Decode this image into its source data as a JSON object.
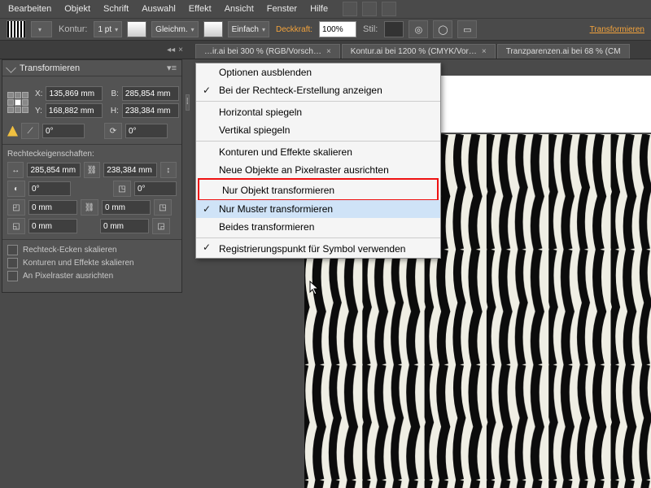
{
  "menubar": [
    "Bearbeiten",
    "Objekt",
    "Schrift",
    "Auswahl",
    "Effekt",
    "Ansicht",
    "Fenster",
    "Hilfe"
  ],
  "toolbar": {
    "kontur_label": "Kontur:",
    "stroke_value": "1 pt",
    "dash1": "Gleichm.",
    "dash2": "Einfach",
    "opacity_label": "Deckkraft:",
    "opacity_value": "100%",
    "style_label": "Stil:",
    "right_link": "Transformieren"
  },
  "tabs": [
    {
      "label": "…ir.ai bei 300 % (RGB/Vorsch…"
    },
    {
      "label": "Kontur.ai bei 1200 % (CMYK/Vor…"
    },
    {
      "label": "Tranzparenzen.ai bei 68 % (CM"
    }
  ],
  "panel": {
    "title": "Transformieren",
    "x_label": "X:",
    "x_val": "135,869 mm",
    "y_label": "Y:",
    "y_val": "168,882 mm",
    "b_label": "B:",
    "b_val": "285,854 mm",
    "h_label": "H:",
    "h_val": "238,384 mm",
    "shear": "0°",
    "rotate": "0°",
    "rect_header": "Rechteckeigenschaften:",
    "rw": "285,854 mm",
    "rh": "238,384 mm",
    "ang1": "0°",
    "ang2": "0°",
    "c1": "0 mm",
    "c2": "0 mm",
    "c3": "0 mm",
    "c4": "0 mm",
    "opt1": "Rechteck-Ecken skalieren",
    "opt2": "Konturen und Effekte skalieren",
    "opt3": "An Pixelraster ausrichten"
  },
  "menu": {
    "m1": "Optionen ausblenden",
    "m2": "Bei der Rechteck-Erstellung anzeigen",
    "m3": "Horizontal spiegeln",
    "m4": "Vertikal spiegeln",
    "m5": "Konturen und Effekte skalieren",
    "m6": "Neue Objekte an Pixelraster ausrichten",
    "m7": "Nur Objekt transformieren",
    "m8": "Nur Muster transformieren",
    "m9": "Beides transformieren",
    "m10": "Registrierungspunkt für Symbol verwenden",
    "chk2": true,
    "chk8": true,
    "chk10": true
  }
}
